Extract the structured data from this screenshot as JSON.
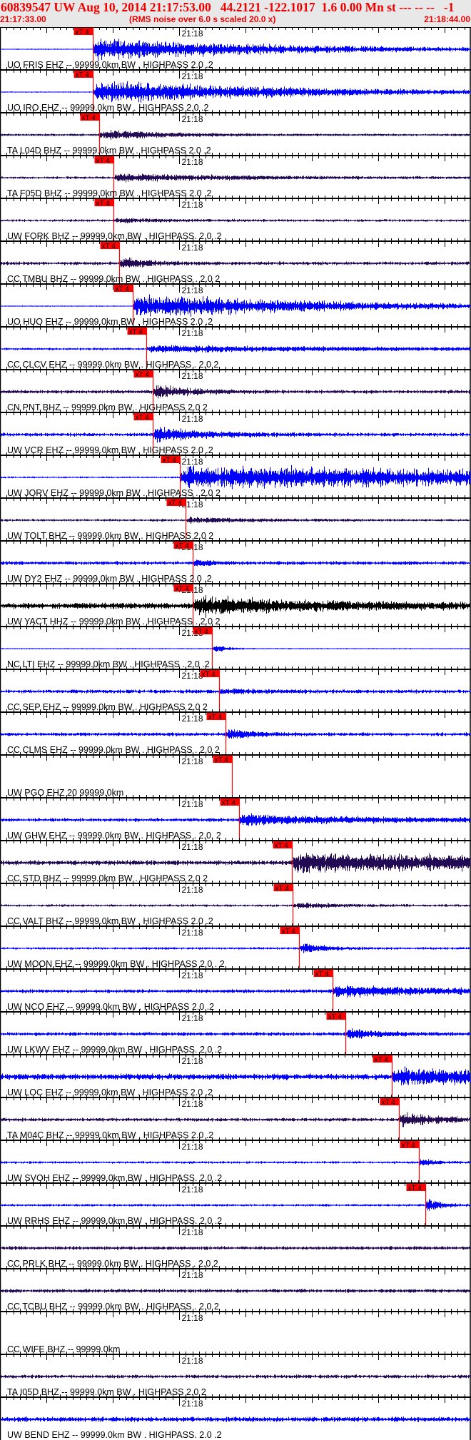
{
  "header": {
    "title": "60839547 UW Aug 10, 2014 21:17:53.00   44.2121 -122.1017  1.6 0.00 Mn st --- -- --   -1",
    "start_time": "21:17:33.00",
    "rms_note": "(RMS noise over 6.0 s scaled 20.0 x)",
    "end_time": "21:18:44.00"
  },
  "axis": {
    "minute_label": "21:18",
    "minute_offset_s": 27,
    "duration_s": 71,
    "pick_label": "xT 4"
  },
  "colors": {
    "header_text": "#ee0000",
    "header_bg": "#e8e8e8",
    "pick": "#ff0000",
    "ehz": "#0000ff",
    "bhz": "#220a55",
    "hhz": "#000000"
  },
  "traces": [
    {
      "label": "UO FRIS EHZ -- 99999.0km BW . HIGHPASS  2.0 .2",
      "color": "#0000ff",
      "pick_s": 14.0,
      "noise": 1,
      "signal": 18,
      "decay": 30
    },
    {
      "label": "UO IRO EHZ -- 99999.0km BW . HIGHPASS  2.0 .2",
      "color": "#0000ff",
      "pick_s": 14.0,
      "noise": 1,
      "signal": 20,
      "decay": 30
    },
    {
      "label": "TA L04D BHZ -- 99999.0km BW . HIGHPASS  2.0 .2",
      "color": "#220a55",
      "pick_s": 15.0,
      "noise": 2,
      "signal": 8,
      "decay": 10
    },
    {
      "label": "TA F05D BHZ -- 99999.0km BW . HIGHPASS  2.0 .2",
      "color": "#220a55",
      "pick_s": 17.1,
      "noise": 2,
      "signal": 6,
      "decay": 20
    },
    {
      "label": "UW FORK BHZ -- 99999.0km BW . HIGHPASS. 2.0 .2",
      "color": "#220a55",
      "pick_s": 17.1,
      "noise": 2,
      "signal": 3,
      "decay": 10
    },
    {
      "label": "CC TMBU BHZ -- 99999.0km BW . HIGHPASS . 2.0  2",
      "color": "#220a55",
      "pick_s": 18.0,
      "noise": 3,
      "signal": 10,
      "decay": 4
    },
    {
      "label": "UO HUO EHZ -- 99999.0km BW . HIGHPASS  2.0 .2",
      "color": "#0000ff",
      "pick_s": 20.0,
      "noise": 1,
      "signal": 20,
      "decay": 30
    },
    {
      "label": "CC CLCV EHZ -- 99999.0km BW . HIGHPASS . 2.0  2",
      "color": "#0000ff",
      "pick_s": 22.0,
      "noise": 2,
      "signal": 5,
      "decay": 40
    },
    {
      "label": "CN PNT BHZ -- 99999.0km BW . HIGHPASS  2.0  2",
      "color": "#220a55",
      "pick_s": 23.0,
      "noise": 3,
      "signal": 12,
      "decay": 5
    },
    {
      "label": "UW VCR EHZ -- 99999.0km BW . HIGHPASS  2.0 .2",
      "color": "#0000ff",
      "pick_s": 23.0,
      "noise": 3,
      "signal": 12,
      "decay": 8
    },
    {
      "label": "UW JORV EHZ -- 99999.0km BW . HIGHPASS . 2.0  2",
      "color": "#0000ff",
      "pick_s": 27.1,
      "noise": 1.5,
      "signal": 20,
      "decay": 80
    },
    {
      "label": "UW TOLT BHZ -- 99999.0km BW . HIGHPASS  2.0  2",
      "color": "#220a55",
      "pick_s": 28.0,
      "noise": 2,
      "signal": 4,
      "decay": 10
    },
    {
      "label": "UW DY2 EHZ -- 99999.0km BW . HIGHPASS  2.0 .2",
      "color": "#0000ff",
      "pick_s": 29.0,
      "noise": 3,
      "signal": 6,
      "decay": 3
    },
    {
      "label": "UW YACT HHZ -- 99999.0km BW . HIGHPASS . 2.0  2",
      "color": "#000000",
      "pick_s": 29.0,
      "noise": 5,
      "signal": 14,
      "decay": 20
    },
    {
      "label": "NC LTI EHZ -- 99999.0km BW . HIGHPASS . 2.0 .2",
      "color": "#0000ff",
      "pick_s": 32.0,
      "noise": 1,
      "signal": 8,
      "decay": 2
    },
    {
      "label": "CC SEP EHZ -- 99999.0km BW . HIGHPASS  2.0  2",
      "color": "#0000ff",
      "pick_s": 33.0,
      "noise": 3,
      "signal": 3,
      "decay": 10
    },
    {
      "label": "CC CLMS EHZ -- 99999.0km BW . HIGHPASS . 2.0  2",
      "color": "#0000ff",
      "pick_s": 34.0,
      "noise": 3,
      "signal": 8,
      "decay": 4
    },
    {
      "label": "UW PGO EHZ 20 99999.0km",
      "color": null,
      "pick_s": 35.0,
      "noise": 0,
      "signal": 0,
      "decay": 1
    },
    {
      "label": "UW GHW EHZ -- 99999.0km BW . HIGHPASS . 2.0. 2",
      "color": "#0000ff",
      "pick_s": 36.0,
      "noise": 3,
      "signal": 8,
      "decay": 20
    },
    {
      "label": "CC STD BHZ -- 99999.0km BW . HIGHPASS  2.0  2",
      "color": "#220a55",
      "pick_s": 44.0,
      "noise": 4,
      "signal": 14,
      "decay": 60
    },
    {
      "label": "CC VALT BHZ -- 99999.0km BW . HIGHPASS  2.0 .2",
      "color": "#220a55",
      "pick_s": 44.1,
      "noise": 2,
      "signal": 4,
      "decay": 8
    },
    {
      "label": "UW MOON EHZ -- 99999.0km BW . HIGHPASS  2.0 . 2",
      "color": "#0000ff",
      "pick_s": 45.1,
      "noise": 2,
      "signal": 8,
      "decay": 4
    },
    {
      "label": "UW NCO EHZ -- 99999.0km BW . HIGHPASS  2.0 .2",
      "color": "#0000ff",
      "pick_s": 50.1,
      "noise": 3,
      "signal": 10,
      "decay": 15
    },
    {
      "label": "UW LKWV EHZ -- 99999.0km BW . HIGHPASS. 2.0 .2",
      "color": "#0000ff",
      "pick_s": 52.1,
      "noise": 3,
      "signal": 10,
      "decay": 4
    },
    {
      "label": "UW LOC EHZ -- 99999.0km BW . HIGHPASS  2.0 .2",
      "color": "#0000ff",
      "pick_s": 59.1,
      "noise": 5,
      "signal": 12,
      "decay": 30
    },
    {
      "label": "TA M04C BHZ -- 99999.0km BW . HIGHPASS  2.0 .2",
      "color": "#220a55",
      "pick_s": 60.1,
      "noise": 3,
      "signal": 12,
      "decay": 6
    },
    {
      "label": "UW SVOH EHZ -- 99999.0km BW . HIGHPASS. 2.0 .2",
      "color": "#0000ff",
      "pick_s": 63.1,
      "noise": 2,
      "signal": 8,
      "decay": 2
    },
    {
      "label": "UW RRHS EHZ -- 99999.0km BW . HIGHPASS. 2.0 .2",
      "color": "#0000ff",
      "pick_s": 64.1,
      "noise": 2,
      "signal": 14,
      "decay": 2
    },
    {
      "label": "CC PRLK BHZ -- 99999.0km BW . HIGHPASS . 2.0  2",
      "color": "#220a55",
      "pick_s": null,
      "noise": 3,
      "signal": 0,
      "decay": 1
    },
    {
      "label": "CC TCBU BHZ -- 99999.0km BW . HIGHPASS . 2.0  2",
      "color": "#220a55",
      "pick_s": null,
      "noise": 3,
      "signal": 0,
      "decay": 1
    },
    {
      "label": "CC WIFE BHZ -- 99999.0km",
      "color": null,
      "pick_s": null,
      "noise": 0,
      "signal": 0,
      "decay": 1
    },
    {
      "label": "TA I05D BHZ -- 99999.0km BW . HIGHPASS  2.0  2",
      "color": "#220a55",
      "pick_s": null,
      "noise": 3,
      "signal": 0,
      "decay": 1
    },
    {
      "label": "UW BEND EHZ -- 99999.0km BW . HIGHPASS. 2.0 .2",
      "color": "#0000ff",
      "pick_s": null,
      "noise": 4,
      "signal": 0,
      "decay": 1
    }
  ]
}
